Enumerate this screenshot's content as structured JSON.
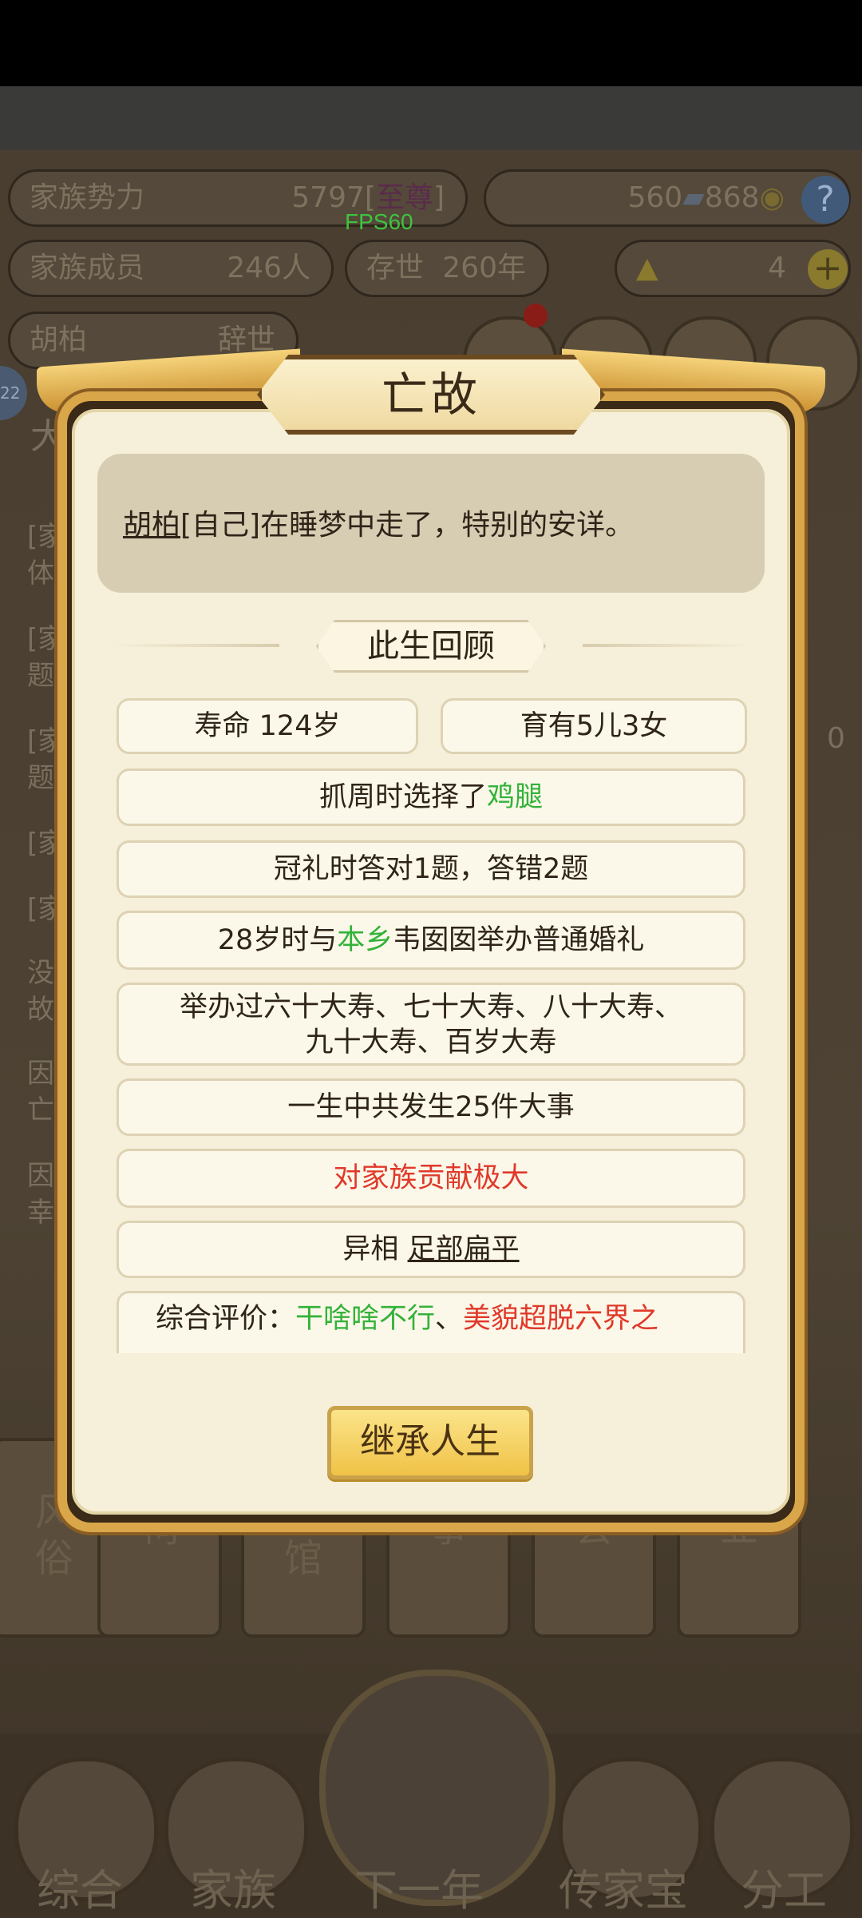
{
  "background": {
    "family_power": {
      "label": "家族势力",
      "value": "5797",
      "rank": "至尊"
    },
    "currency": {
      "silver": "560",
      "coins": "868"
    },
    "fps": "FPS60",
    "family_members": {
      "label": "家族成员",
      "value": "246人"
    },
    "survival": {
      "label": "存世",
      "value": "260年"
    },
    "gold": "4",
    "person": {
      "name": "胡柏",
      "status": "辞世"
    },
    "level_badge": "22",
    "left_tag": "大",
    "log_lines": [
      "[家",
      "体",
      "[家",
      "题",
      "[家",
      "题",
      "[家",
      "[家",
      "没",
      "故",
      "因",
      "亡",
      "因",
      "幸"
    ],
    "right_number": "0",
    "tabs": [
      "风\n俗",
      "祠",
      "娘\n馆",
      "事",
      "会",
      "业"
    ],
    "nav": [
      "综合",
      "家族",
      "下一年",
      "传家宝",
      "分工"
    ]
  },
  "dialog": {
    "title": "亡故",
    "message": {
      "name": "胡柏",
      "rest": "[自己]在睡梦中走了，特别的安详。"
    },
    "section_title": "此生回顾",
    "lifespan": "寿命 124岁",
    "children": "育有5儿3女",
    "zhuazhou": {
      "prefix": "抓周时选择了",
      "item": "鸡腿"
    },
    "guanli": "冠礼时答对1题，答错2题",
    "marriage": {
      "prefix": "28岁时与",
      "place": "本乡",
      "suffix": "韦囡囡举办普通婚礼"
    },
    "birthdays": {
      "line1": "举办过六十大寿、七十大寿、八十大寿、",
      "line2": "九十大寿、百岁大寿"
    },
    "events": "一生中共发生25件大事",
    "contribution": "对家族贡献极大",
    "trait": {
      "prefix": "异相 ",
      "value": "足部扁平"
    },
    "evaluation": {
      "prefix": "综合评价：",
      "green_part": "干啥啥不行",
      "sep": "、",
      "red_part": "美貌超脱六界之"
    },
    "button": "继承人生"
  }
}
